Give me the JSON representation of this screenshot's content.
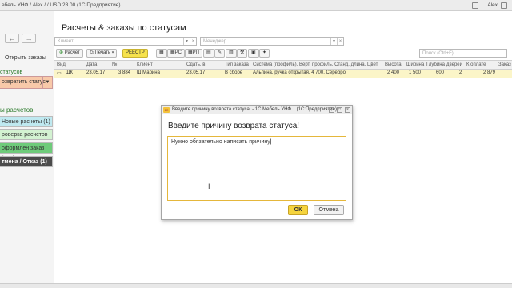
{
  "titlebar": {
    "text": "ебель УНФ / Alex / / USD 28.00 (1С:Предприятие)",
    "user": "Alex"
  },
  "sidebar": {
    "open_orders": "Открыть заказы",
    "statuses_link": "статусов",
    "dropdown_label": "озвратить статус",
    "section_label": "ы расчетов",
    "items": [
      {
        "label": "Новые расчеты (1)",
        "bg": "#bfe9f0"
      },
      {
        "label": "роверка расчетов (2)",
        "bg": "#d3f2d1"
      },
      {
        "label": "оформлен заказ (217)",
        "bg": "#6ecb7a"
      },
      {
        "label": "тмена / Отказ (1)",
        "bg": "#4b4b4b"
      }
    ]
  },
  "main": {
    "title": "Расчеты & заказы по статусам",
    "filter_client": "Клиент",
    "filter_manager": "Менеджер",
    "search_placeholder": "Поиск (Ctrl+F)"
  },
  "toolbar": {
    "raschet": "Расчет",
    "print": "Печать",
    "reestr": "РЕЕСТР",
    "rs": "РС",
    "rp": "РП"
  },
  "table": {
    "columns": [
      "Вид",
      "Дата",
      "№",
      "Клиент",
      "Сдать, в",
      "Тип заказа",
      "Система (профиль), Верт. профиль, Станд. длина, Цвет",
      "Высота",
      "Ширина",
      "Глубина",
      "дверей",
      "К оплате",
      "Заказ"
    ],
    "row": [
      "ШК",
      "23.05.17",
      "3 884",
      "Ш Марина",
      "23.05.17",
      "В сборе",
      "Альпина, ручка открытая, 4 700, Серебро",
      "2 400",
      "1 500",
      "600",
      "2",
      "2 879",
      ""
    ]
  },
  "dialog": {
    "window_title": "Введите причину возврата статуса! - 1С:Мебель УНФ... (1С:Предприятие)",
    "heading": "Введите причину возврата статуса!",
    "text": "Нужно обязательно написать причину",
    "ok": "ОК",
    "cancel": "Отмена"
  },
  "colors": {
    "accent_yellow": "#f5d43e",
    "row_highlight": "#fbf5c8",
    "dropdown_peach": "#f8c9a9"
  }
}
